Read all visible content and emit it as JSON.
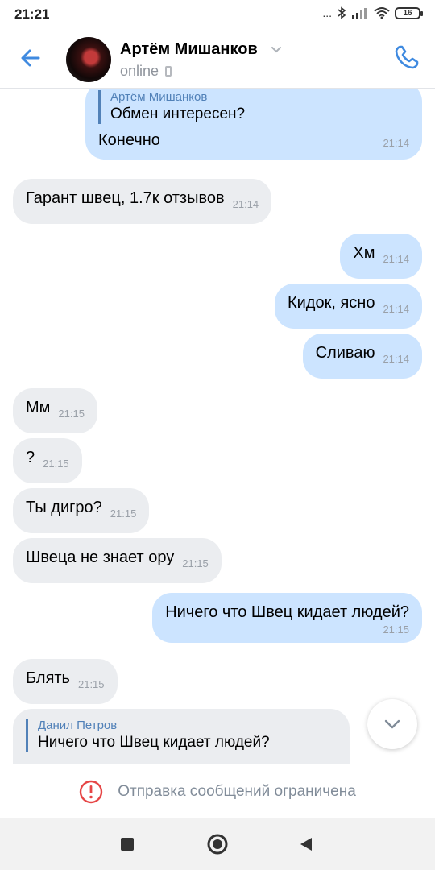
{
  "status_bar": {
    "time": "21:21",
    "signal_dots": "...",
    "battery": "16"
  },
  "header": {
    "contact_name": "Артём Мишанков",
    "contact_status": "online"
  },
  "messages": [
    {
      "dir": "out",
      "reply_author": "Артём Мишанков",
      "reply_text": "Обмен интересен?",
      "text": "Конечно",
      "time": "21:14"
    },
    {
      "dir": "in",
      "text": "Гарант швец, 1.7к отзывов",
      "time": "21:14"
    },
    {
      "dir": "out",
      "text": "Хм",
      "time": "21:14"
    },
    {
      "dir": "out",
      "text": "Кидок, ясно",
      "time": "21:14"
    },
    {
      "dir": "out",
      "text": "Сливаю",
      "time": "21:14"
    },
    {
      "dir": "in",
      "text": "Мм",
      "time": "21:15"
    },
    {
      "dir": "in",
      "text": "?",
      "time": "21:15"
    },
    {
      "dir": "in",
      "text": "Ты дигро?",
      "time": "21:15"
    },
    {
      "dir": "in",
      "text": "Швеца не знает ору",
      "time": "21:15"
    },
    {
      "dir": "out",
      "text": "Ничего что Швец кидает людей?",
      "time": "21:15"
    },
    {
      "dir": "in",
      "text": "Блять",
      "time": "21:15"
    },
    {
      "dir": "in",
      "reply_author": "Данил Петров",
      "reply_text": "Ничего что Швец кидает людей?"
    }
  ],
  "composer": {
    "notice": "Отправка сообщений ограничена"
  },
  "icons": {
    "back": "arrow-left-icon",
    "call": "phone-icon",
    "scroll": "chevron-down-icon",
    "notice": "exclamation-circle-icon",
    "nav": [
      "square-icon",
      "circle-icon",
      "triangle-back-icon"
    ]
  },
  "colors": {
    "accent": "#5181b8",
    "outgoing": "#cce4ff",
    "incoming": "#ebedf0",
    "alert": "#e64646"
  }
}
